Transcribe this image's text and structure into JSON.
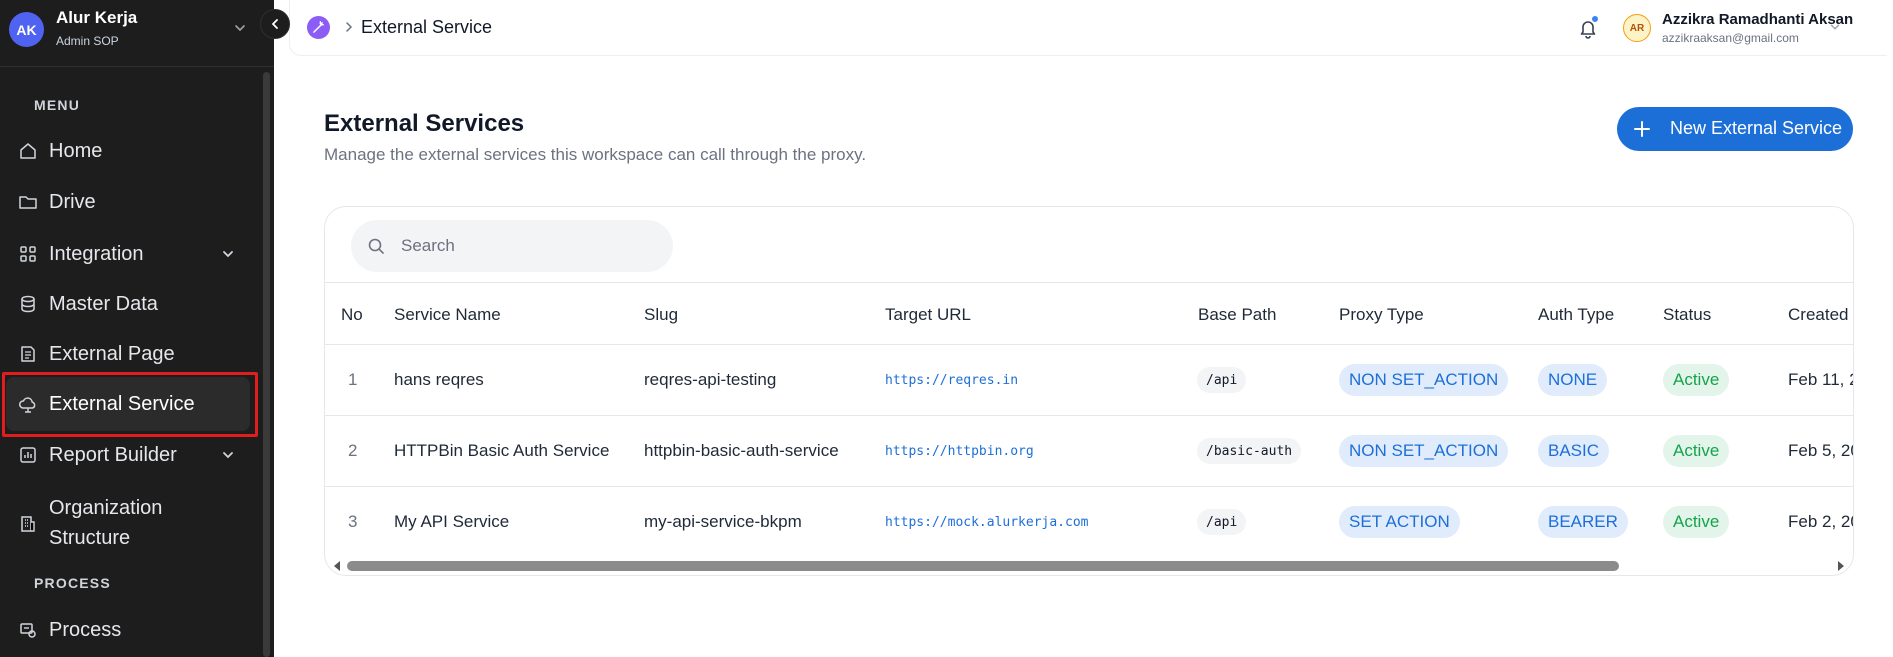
{
  "sidebar": {
    "avatar_initials": "AK",
    "org_name": "Alur Kerja",
    "role": "Admin SOP",
    "sections": {
      "menu": "MENU",
      "process": "PROCESS"
    },
    "items": [
      {
        "label": "Home",
        "icon": "home-icon"
      },
      {
        "label": "Drive",
        "icon": "folder-icon"
      },
      {
        "label": "Integration",
        "icon": "grid-icon",
        "has_children": true
      },
      {
        "label": "Master Data",
        "icon": "database-icon"
      },
      {
        "label": "External Page",
        "icon": "page-icon"
      },
      {
        "label": "External Service",
        "icon": "cloud-icon",
        "active": true
      },
      {
        "label": "Report Builder",
        "icon": "report-icon",
        "has_children": true
      },
      {
        "label": "Organization Structure",
        "label_line1": "Organization",
        "label_line2": "Structure",
        "icon": "building-icon"
      },
      {
        "label": "Process",
        "icon": "process-icon"
      }
    ]
  },
  "topbar": {
    "breadcrumb": "External Service",
    "user_initials": "AR",
    "user_name": "Azzikra Ramadhanti Aksan",
    "user_email": "azzikraaksan@gmail.com"
  },
  "page": {
    "title": "External Services",
    "subtitle": "Manage the external services this workspace can call through the proxy.",
    "new_button": "New External Service"
  },
  "search": {
    "placeholder": "Search"
  },
  "table": {
    "columns": [
      "No",
      "Service Name",
      "Slug",
      "Target URL",
      "Base Path",
      "Proxy Type",
      "Auth Type",
      "Status",
      "Created"
    ],
    "rows": [
      {
        "no": "1",
        "name": "hans reqres",
        "slug": "reqres-api-testing",
        "url": "https://reqres.in",
        "base_path": "/api",
        "proxy_type": "NON SET_ACTION",
        "auth_type": "NONE",
        "status": "Active",
        "created": "Feb 11, 2"
      },
      {
        "no": "2",
        "name": "HTTPBin Basic Auth Service",
        "slug": "httpbin-basic-auth-service",
        "url": "https://httpbin.org",
        "base_path": "/basic-auth",
        "proxy_type": "NON SET_ACTION",
        "auth_type": "BASIC",
        "status": "Active",
        "created": "Feb 5, 20"
      },
      {
        "no": "3",
        "name": "My API Service",
        "slug": "my-api-service-bkpm",
        "url": "https://mock.alurkerja.com",
        "base_path": "/api",
        "proxy_type": "SET ACTION",
        "auth_type": "BEARER",
        "status": "Active",
        "created": "Feb 2, 20"
      }
    ]
  },
  "colors": {
    "sidebar_bg": "#1d1d1d",
    "accent": "#1d6fd8",
    "status_active": "#16a34a",
    "highlight_outline": "#e11d1d"
  }
}
